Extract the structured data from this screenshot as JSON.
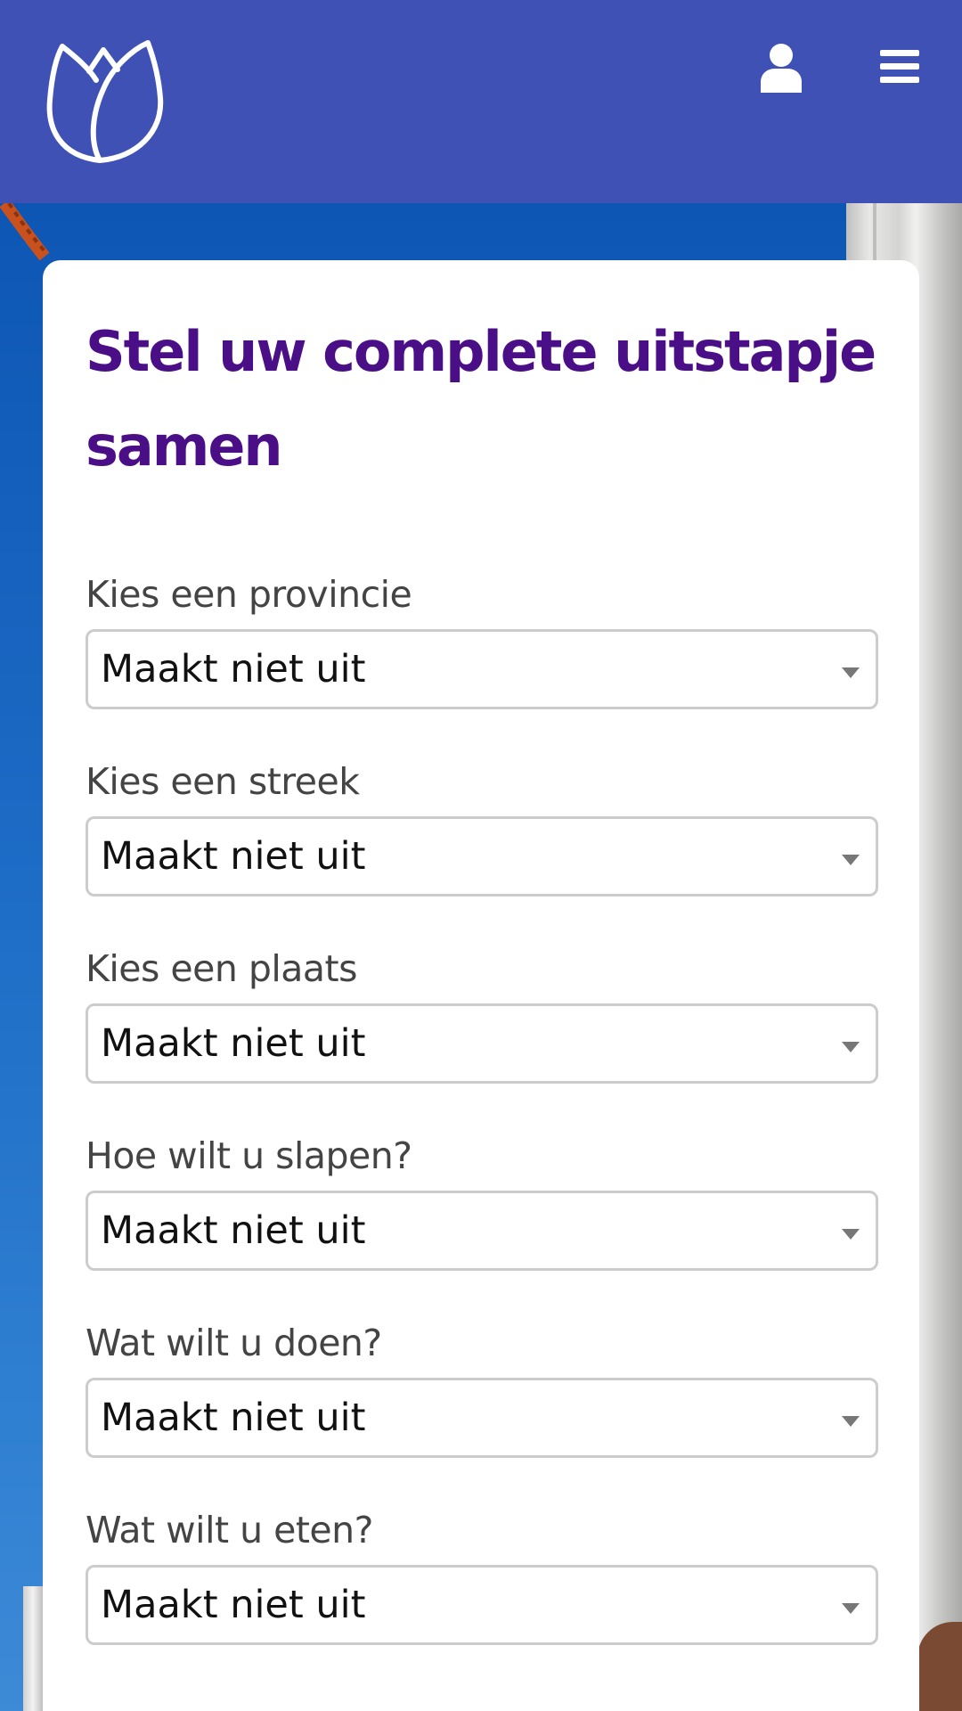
{
  "header": {
    "logo_icon": "tulip-logo-icon",
    "user_icon": "user-icon",
    "menu_icon": "hamburger-menu-icon",
    "background_color": "#3f51b5"
  },
  "form": {
    "title": "Stel uw complete uitstapje samen",
    "title_color": "#4a0e86",
    "fields": [
      {
        "label": "Kies een provincie",
        "value": "Maakt niet uit"
      },
      {
        "label": "Kies een streek",
        "value": "Maakt niet uit"
      },
      {
        "label": "Kies een plaats",
        "value": "Maakt niet uit"
      },
      {
        "label": "Hoe wilt u slapen?",
        "value": "Maakt niet uit"
      },
      {
        "label": "Wat wilt u doen?",
        "value": "Maakt niet uit"
      },
      {
        "label": "Wat wilt u eten?",
        "value": "Maakt niet uit"
      }
    ]
  }
}
